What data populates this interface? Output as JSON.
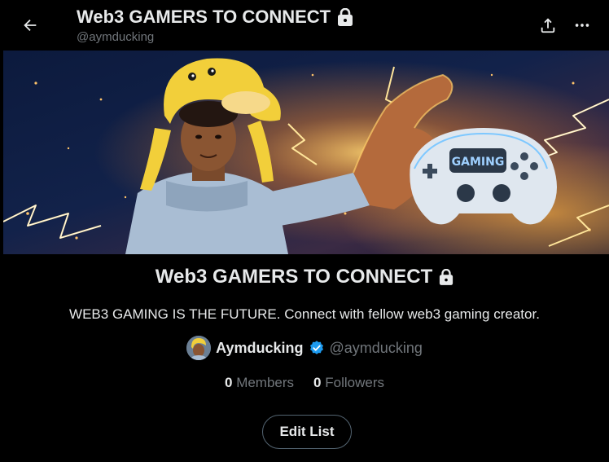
{
  "header": {
    "title": "Web3 GAMERS TO CONNECT",
    "handle": "@aymducking",
    "back_icon": "arrow-left-icon",
    "share_icon": "share-icon",
    "more_icon": "more-horizontal-icon"
  },
  "list": {
    "title": "Web3 GAMERS TO CONNECT",
    "locked": true,
    "description": "WEB3 GAMING IS THE FUTURE. Connect with fellow web3 gaming creator.",
    "owner": {
      "name": "Aymducking",
      "handle": "@aymducking",
      "verified": true
    },
    "stats": {
      "members_count": "0",
      "members_label": "Members",
      "followers_count": "0",
      "followers_label": "Followers"
    },
    "edit_label": "Edit List"
  },
  "colors": {
    "background": "#000000",
    "text_primary": "#e7e9ea",
    "text_secondary": "#71767b",
    "verified_blue": "#1d9bf0",
    "button_border": "#536471"
  }
}
